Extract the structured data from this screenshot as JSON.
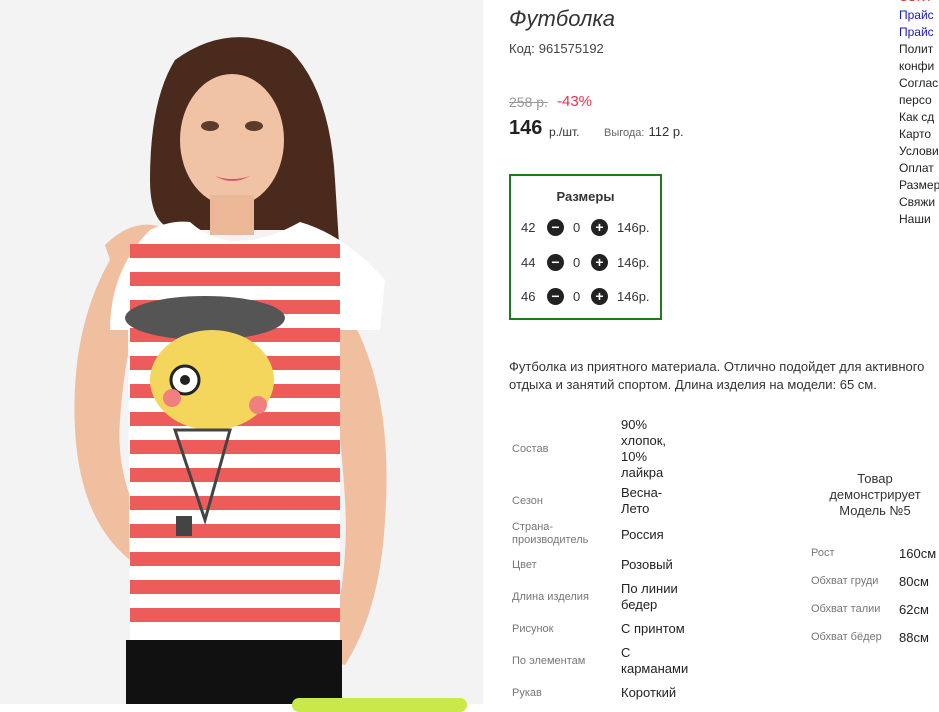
{
  "product": {
    "title": "Футболка",
    "code_label": "Код:",
    "code_value": "961575192",
    "old_price": "258 р.",
    "discount": "-43%",
    "price": "146",
    "price_unit": "р./шт.",
    "savings_label": "Выгода:",
    "savings_value": "112 р."
  },
  "sizes": {
    "title": "Размеры",
    "rows": [
      {
        "size": "42",
        "qty": "0",
        "price": "146р."
      },
      {
        "size": "44",
        "qty": "0",
        "price": "146р."
      },
      {
        "size": "46",
        "qty": "0",
        "price": "146р."
      }
    ]
  },
  "description": {
    "line1": "Футболка из приятного материала. Отлично подойдет для активного",
    "line2": "отдыха и занятий спортом. Длина изделия на модели: 65 см."
  },
  "properties": [
    {
      "label": "Состав",
      "value": "90% хлопок, 10% лайкра"
    },
    {
      "label": "Сезон",
      "value": "Весна-Лето"
    },
    {
      "label": "Страна-производитель",
      "value": "Россия"
    },
    {
      "label": "Цвет",
      "value": "Розовый"
    },
    {
      "label": "Длина изделия",
      "value": "По линии бедер"
    },
    {
      "label": "Рисунок",
      "value": "С принтом"
    },
    {
      "label": "По элементам",
      "value": "С карманами"
    },
    {
      "label": "Рукав",
      "value": "Короткий"
    }
  ],
  "model": {
    "title": "Товар демонстрирует Модель №5",
    "measurements": [
      {
        "label": "Рост",
        "value": "160см"
      },
      {
        "label": "Обхват груди",
        "value": "80см"
      },
      {
        "label": "Обхват талии",
        "value": "62см"
      },
      {
        "label": "Обхват бёдер",
        "value": "88см"
      }
    ]
  },
  "sidebar": {
    "links": [
      "Прайс",
      "Прайс",
      "Полит",
      "конфи",
      "Соглас",
      "персо",
      "Как сд",
      "Карто",
      "Услови",
      "Оплат",
      "Размер",
      "Свяжи",
      "Наши"
    ]
  },
  "colors": {
    "accent_discount": "#e0344e",
    "sizes_border": "#1f7a1f",
    "link_blue": "#1a1ab8"
  },
  "icons": {
    "minus": "minus-circle-icon",
    "plus": "plus-circle-icon"
  }
}
